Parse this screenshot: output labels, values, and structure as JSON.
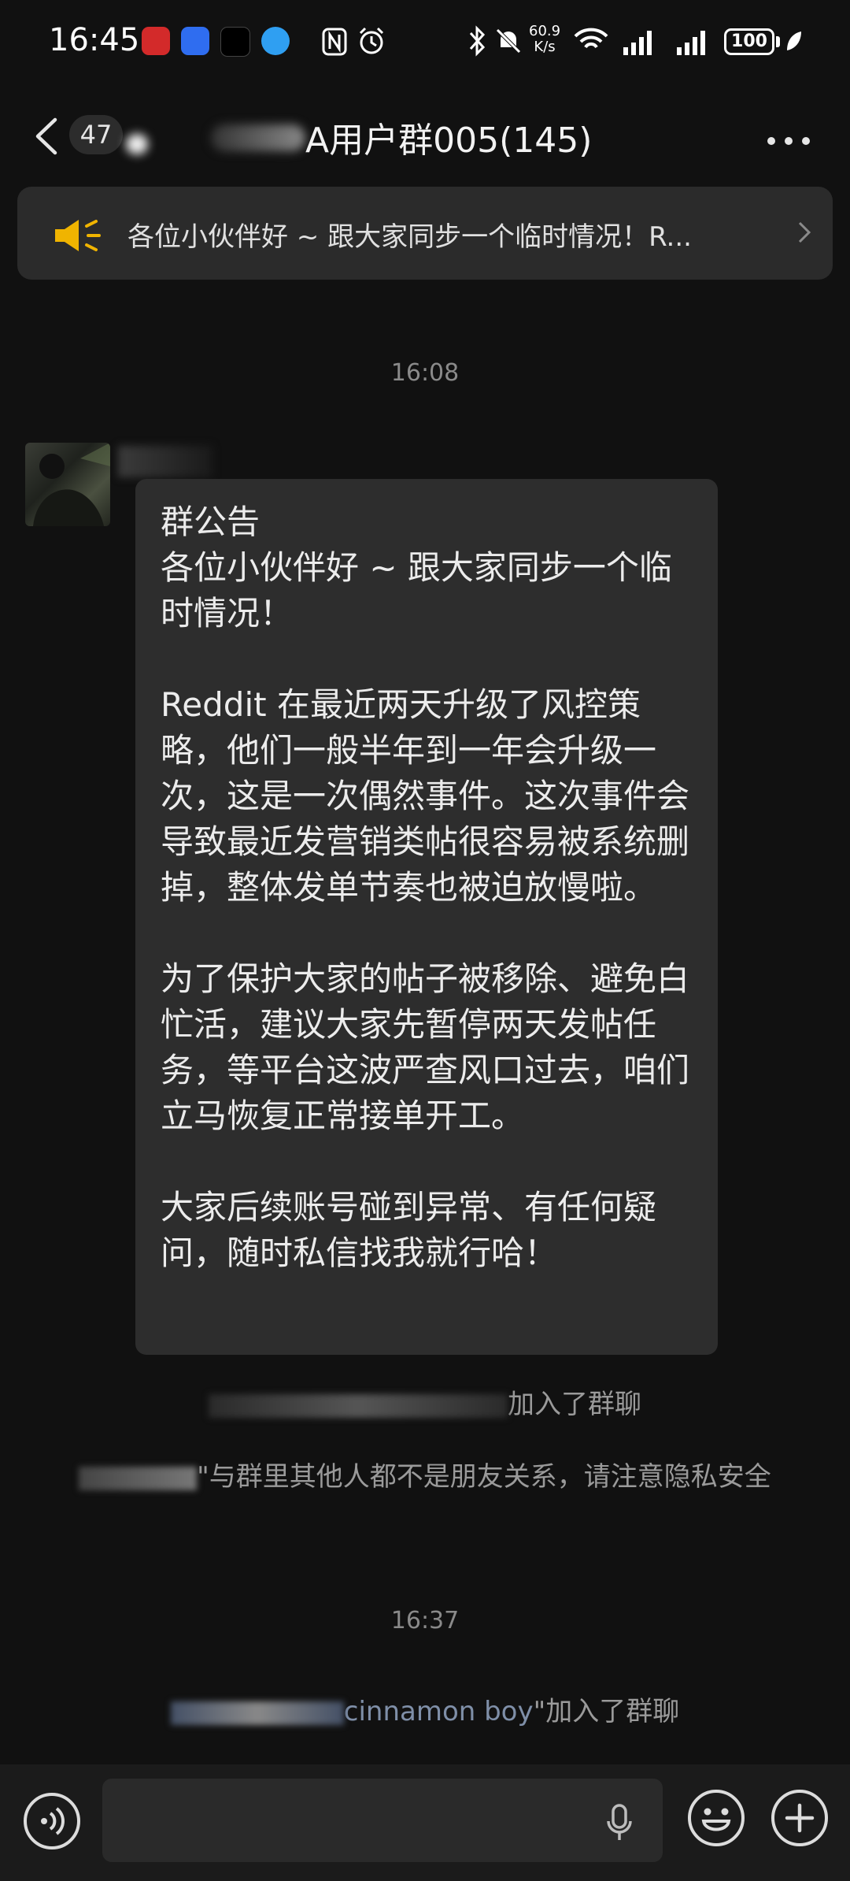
{
  "status_bar": {
    "time": "16:45",
    "net_speed_value": "60.9",
    "net_speed_unit": "K/s",
    "battery": "100"
  },
  "header": {
    "unread_count": "47",
    "group_title": "A用户群005(145)"
  },
  "announcement": {
    "text": "各位小伙伴好 ~ 跟大家同步一个临时情况！R..."
  },
  "messages": {
    "time_1": "16:08",
    "bubble_title": "群公告",
    "para_1": "各位小伙伴好 ~ 跟大家同步一个临时情况！",
    "para_2": "Reddit 在最近两天升级了风控策略，他们一般半年到一年会升级一次，这是一次偶然事件。这次事件会导致最近发营销类帖很容易被系统删掉，整体发单节奏也被迫放慢啦。",
    "para_3": "为了保护大家的帖子被移除、避免白忙活，建议大家先暂停两天发帖任务，等平台这波严查风口过去，咱们立马恢复正常接单开工。",
    "para_4": "大家后续账号碰到异常、有任何疑问，随时私信找我就行哈！",
    "sys_join_1_suffix": "加入了群聊",
    "sys_privacy_suffix": "\"与群里其他人都不是朋友关系，请注意隐私安全",
    "time_2": "16:37",
    "sys_join_2_name": "cinnamon boy",
    "sys_join_2_suffix": "\"加入了群聊"
  },
  "colors": {
    "background": "#111111",
    "bubble": "#2d2d2d",
    "banner": "#2b2b2b",
    "accent_speaker": "#f0b400"
  }
}
